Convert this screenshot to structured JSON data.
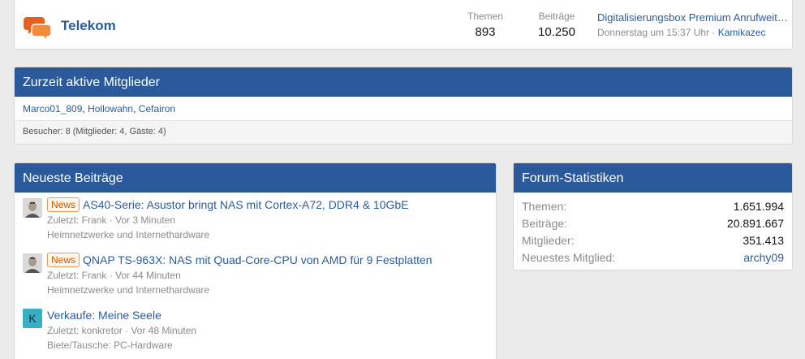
{
  "node": {
    "title": "Telekom",
    "themes_label": "Themen",
    "themes_value": "893",
    "posts_label": "Beiträge",
    "posts_value": "10.250",
    "latest_title": "Digitalisierungsbox Premium Anrufweiterleitung",
    "latest_date": "Donnerstag um 15:37 Uhr",
    "latest_sep": " · ",
    "latest_user": "Kamikazec",
    "icon": "chat-bubbles-icon"
  },
  "online": {
    "title": "Zurzeit aktive Mitglieder",
    "members": [
      "Marco01_809",
      "Hollowahn",
      "Cefairon"
    ],
    "separator": ", ",
    "footer": "Besucher: 8 (Mitglieder: 4, Gäste: 4)"
  },
  "latest_posts": {
    "title": "Neueste Beiträge",
    "items": [
      {
        "label": "News",
        "title": "AS40-Serie: Asustor bringt NAS mit Cortex-A72, DDR4 & 10GbE",
        "meta": "Zuletzt: Frank · Vor 3 Minuten",
        "forum": "Heimnetzwerke und Internethardware",
        "avatar": "user-photo-icon"
      },
      {
        "label": "News",
        "title": "QNAP TS-963X: NAS mit Quad-Core-CPU von AMD für 9 Festplatten",
        "meta": "Zuletzt: Frank · Vor 44 Minuten",
        "forum": "Heimnetzwerke und Internethardware",
        "avatar": "user-photo-icon"
      },
      {
        "label": "",
        "title": "Verkaufe: Meine Seele",
        "meta": "Zuletzt: konkretor · Vor 48 Minuten",
        "forum": "Biete/Tausche: PC-Hardware",
        "avatar_letter": "K"
      }
    ]
  },
  "stats": {
    "title": "Forum-Statistiken",
    "rows": [
      {
        "label": "Themen:",
        "value": "1.651.994"
      },
      {
        "label": "Beiträge:",
        "value": "20.891.667"
      },
      {
        "label": "Mitglieder:",
        "value": "351.413"
      },
      {
        "label": "Neuestes Mitglied:",
        "value": "archy09"
      }
    ]
  },
  "colors": {
    "header_bg": "#2a5a9b",
    "link": "#2b5c9a",
    "news_label": "#c85a00",
    "node_icon": "#e8611a"
  }
}
